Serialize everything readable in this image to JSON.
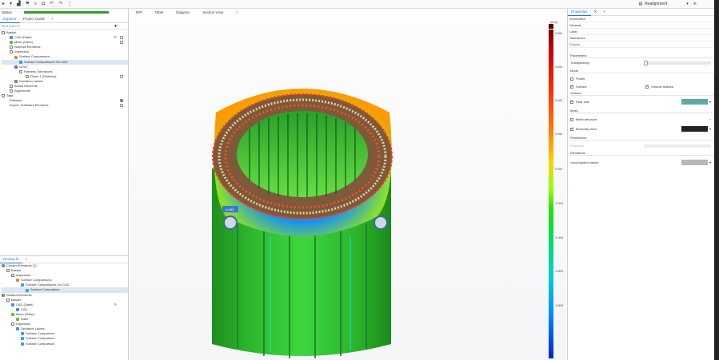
{
  "toolbar": {
    "workspace": "Realignment"
  },
  "explorer": {
    "status_label": "Status",
    "tabs": [
      "Explorer",
      "Project Guide",
      "+"
    ],
    "filter_placeholder": "Find (Ctrl+F)",
    "items": [
      "Basket",
      "CAD (Datei)",
      "Mesh (Datei)",
      "Nominal Elements",
      "Inspection",
      "Surface Comparisons",
      "Surface Comparisons On CAD",
      "GD&T",
      "Flatness Tolerances",
      "Plane 1 (Flatness)",
      "Deviation Labels",
      "Actual Elements",
      "Alignments",
      "Tags",
      "Flatness",
      "Import: Softshare Elements"
    ]
  },
  "review": {
    "tabs": [
      "Review fo",
      "+"
    ],
    "items": [
      "Chosen Elements (1)",
      "Basket",
      "Inspection",
      "Surface Comparisons",
      "Surface Comparisons On CAD",
      "Surface Comparison",
      "Related Elements",
      "Basket",
      "CAD (Datei)",
      "CAD",
      "Mesh (Datei)",
      "Datei",
      "Inspection",
      "Deviation Labels",
      "Surface Comparison",
      "Surface Comparison",
      "Surface Comparison"
    ]
  },
  "viewport": {
    "tabs": [
      "RIP",
      "Table",
      "Diagram",
      "Section View",
      "+"
    ],
    "point_label": "-0.993",
    "legend_unit": "[mm]",
    "legend_ticks": [
      "0.800",
      "0.600",
      "0.400",
      "0.200",
      "0.000",
      "-0.200",
      "-0.400",
      "-0.600",
      "-0.800"
    ]
  },
  "properties": {
    "tab": "Properties",
    "sections_top": [
      "Information",
      "General",
      "Label",
      "Tolerances",
      "Display"
    ],
    "parameters_title": "Parameters",
    "transparency_label": "Transparency",
    "mode_title": "Mode",
    "points_label": "Points",
    "surface_label": "Surface",
    "smooth_label": "Smooth shaded",
    "surface_title": "Surface",
    "rear_side_label": "Rear side",
    "mesh_title": "Mesh",
    "mesh_structure_label": "Mesh structure",
    "boundary_lines_label": "Boundary lines",
    "points_lines_title": "Points/lines",
    "point_size_label": "Point size",
    "deviations_title": "Deviations",
    "uncomputed_label": "Uncomputed values",
    "colors": {
      "rear_side": "#5aa9a9",
      "boundary": "#222222",
      "uncomputed": "#b8b8b8"
    }
  }
}
